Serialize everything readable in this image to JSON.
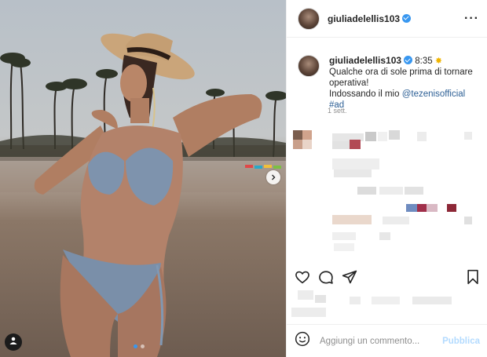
{
  "post": {
    "username": "giuliadelellis103",
    "verified": true
  },
  "caption": {
    "username": "giuliadelellis103",
    "time": "8:35",
    "line1": "Qualche ora di sole prima di tornare",
    "line2": "operativa!",
    "line3_prefix": "Indossando il mio",
    "mention": "@tezenisofficial",
    "hashtag": "#ad",
    "age": "1 sett."
  },
  "comment_box": {
    "placeholder": "Aggiungi un commento...",
    "publish_label": "Pubblica"
  },
  "carousel": {
    "slide_count": 2,
    "active_slide": 1
  },
  "colors": {
    "accent_blue": "#3897f0",
    "text": "#262626",
    "muted": "#8e8e8e",
    "border": "#efefef",
    "publish_disabled": "#b3dbff"
  },
  "icons": [
    "more-options-icon",
    "verified-badge-icon",
    "like-heart-icon",
    "comment-bubble-icon",
    "share-plane-icon",
    "bookmark-icon",
    "emoji-icon",
    "user-tag-icon",
    "next-arrow-icon"
  ]
}
